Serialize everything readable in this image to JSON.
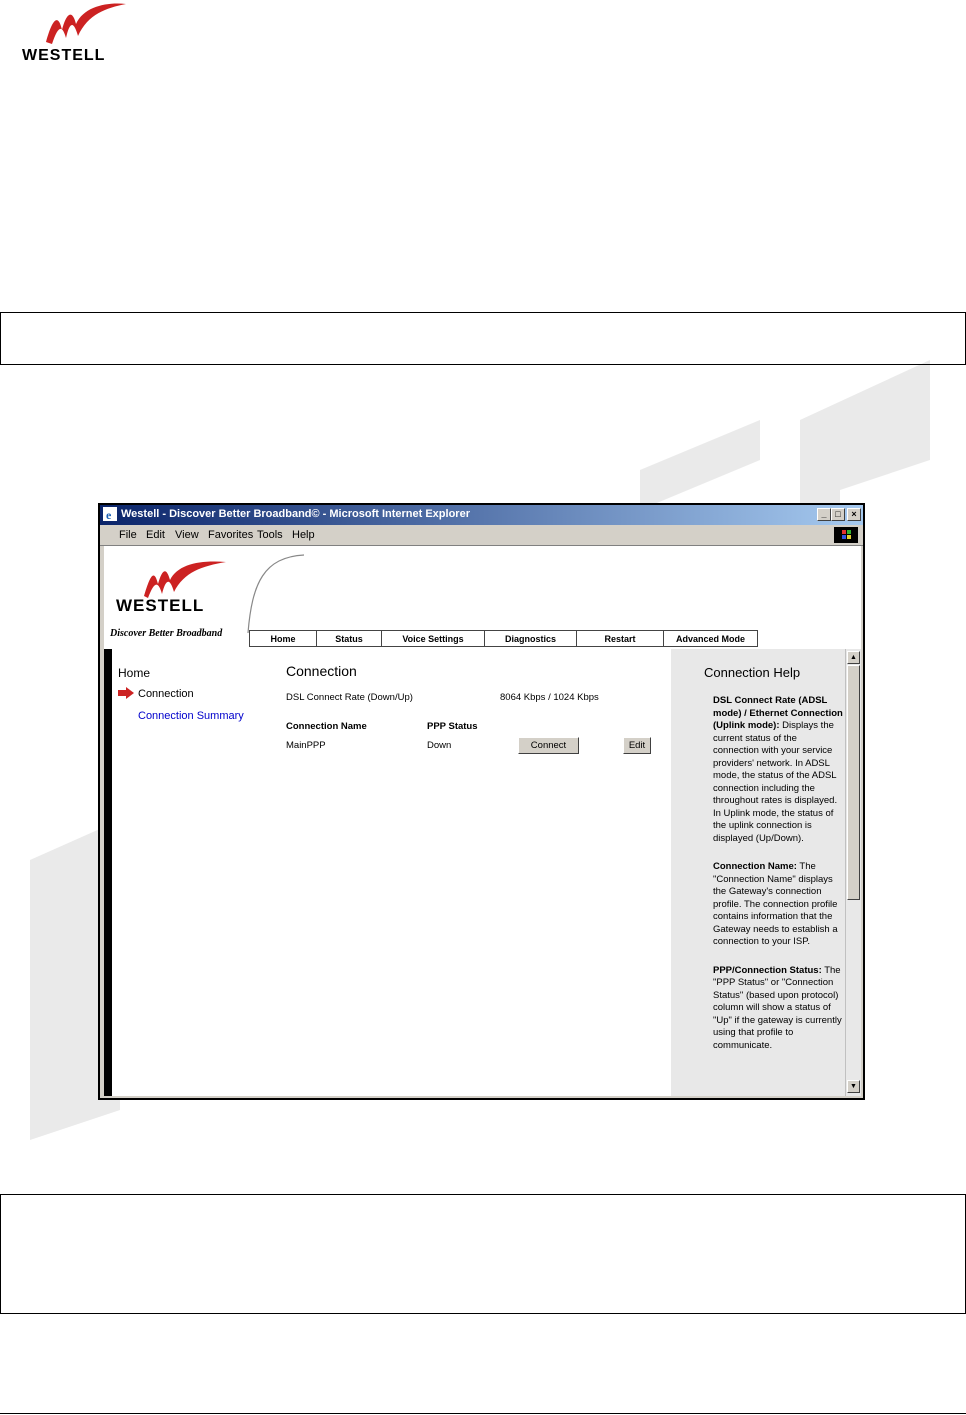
{
  "document": {
    "logo_text": "WESTELL"
  },
  "browser": {
    "title": "Westell - Discover Better Broadband© - Microsoft Internet Explorer",
    "menu": [
      "File",
      "Edit",
      "View",
      "Favorites",
      "Tools",
      "Help"
    ],
    "window_buttons": {
      "minimize": "_",
      "maximize": "□",
      "close": "×"
    }
  },
  "site": {
    "brand": "WESTELL",
    "tagline": "Discover Better Broadband",
    "tabs": [
      "Home",
      "Status",
      "Voice Settings",
      "Diagnostics",
      "Restart",
      "Advanced Mode"
    ],
    "sidebar": {
      "home": "Home",
      "items": [
        "Connection",
        "Connection Summary"
      ]
    },
    "main": {
      "title": "Connection",
      "dsl_label": "DSL Connect Rate (Down/Up)",
      "dsl_value": "8064 Kbps / 1024 Kbps",
      "columns": [
        "Connection Name",
        "PPP Status"
      ],
      "row": {
        "name": "MainPPP",
        "status": "Down",
        "connect": "Connect",
        "edit": "Edit"
      }
    },
    "help": {
      "title": "Connection Help",
      "paragraphs": [
        {
          "head": "DSL Connect Rate (ADSL mode) / Ethernet Connection (Uplink mode):",
          "body": " Displays the current status of the connection with your service providers' network. In ADSL mode, the status of the ADSL connection including the throughout rates is displayed. In Uplink mode, the status of the uplink connection is displayed (Up/Down)."
        },
        {
          "head": "Connection Name:",
          "body": " The \"Connection Name\" displays the Gateway's connection profile. The connection profile contains information that the Gateway needs to establish a connection to your ISP."
        },
        {
          "head": "PPP/Connection Status:",
          "body": " The \"PPP Status\" or \"Connection Status\" (based upon protocol) column will show a status of \"Up\" if the gateway is currently using that profile to communicate."
        }
      ]
    }
  },
  "colors": {
    "accent_red": "#cc2222",
    "link_blue": "#0000cc",
    "title_bar": "#0a246a"
  }
}
